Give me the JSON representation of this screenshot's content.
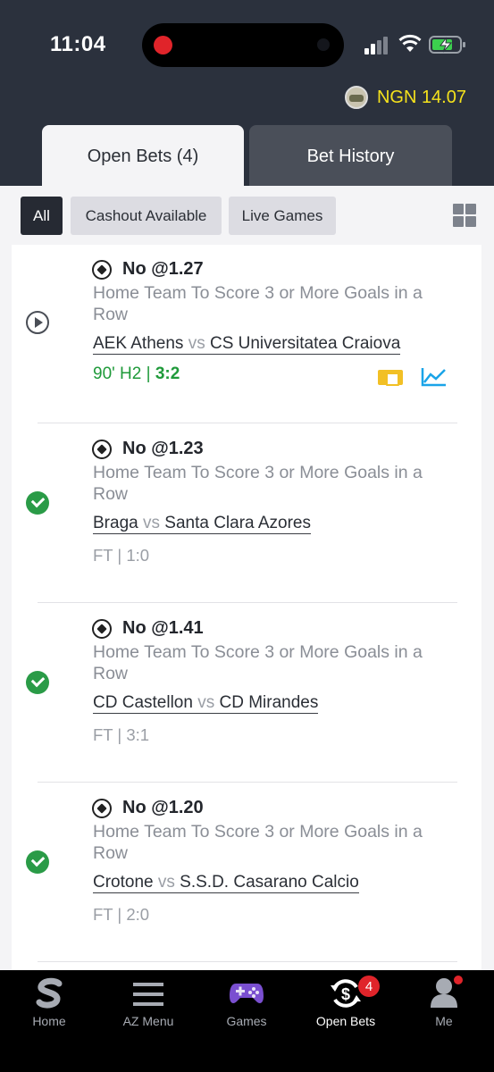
{
  "status_bar": {
    "time": "11:04"
  },
  "header": {
    "balance": "NGN 14.07"
  },
  "tabs": [
    {
      "label": "Open Bets (4)",
      "active": true
    },
    {
      "label": "Bet History",
      "active": false
    }
  ],
  "filters": [
    {
      "label": "All",
      "active": true
    },
    {
      "label": "Cashout Available",
      "active": false
    },
    {
      "label": "Live Games",
      "active": false
    }
  ],
  "bets": [
    {
      "state": "live",
      "pick": "No @1.27",
      "market": "Home Team To Score 3 or More Goals in a Row",
      "home": "AEK Athens",
      "vs": "vs",
      "away": "CS Universitatea Craiova",
      "status_prefix": "90' H2 |",
      "score": "3:2"
    },
    {
      "state": "won",
      "pick": "No @1.23",
      "market": "Home Team To Score 3 or More Goals in a Row",
      "home": "Braga",
      "vs": "vs",
      "away": "Santa Clara Azores",
      "result": "FT | 1:0"
    },
    {
      "state": "won",
      "pick": "No @1.41",
      "market": "Home Team To Score 3 or More Goals in a Row",
      "home": "CD Castellon",
      "vs": "vs",
      "away": "CD Mirandes",
      "result": "FT | 3:1"
    },
    {
      "state": "won",
      "pick": "No @1.20",
      "market": "Home Team To Score 3 or More Goals in a Row",
      "home": "Crotone",
      "vs": "vs",
      "away": "S.S.D. Casarano Calcio",
      "result": "FT | 2:0"
    }
  ],
  "nav": [
    {
      "label": "Home",
      "icon": "sporty-logo-icon"
    },
    {
      "label": "AZ Menu",
      "icon": "hamburger-menu-icon"
    },
    {
      "label": "Games",
      "icon": "gamepad-icon"
    },
    {
      "label": "Open Bets",
      "icon": "open-bets-icon",
      "badge": "4",
      "active": true
    },
    {
      "label": "Me",
      "icon": "user-icon"
    }
  ],
  "colors": {
    "header_bg": "#2b313d",
    "balance": "#f5e21c",
    "live_green": "#1f9a3a",
    "won_green": "#2a9b47",
    "badge_red": "#e0242a"
  }
}
